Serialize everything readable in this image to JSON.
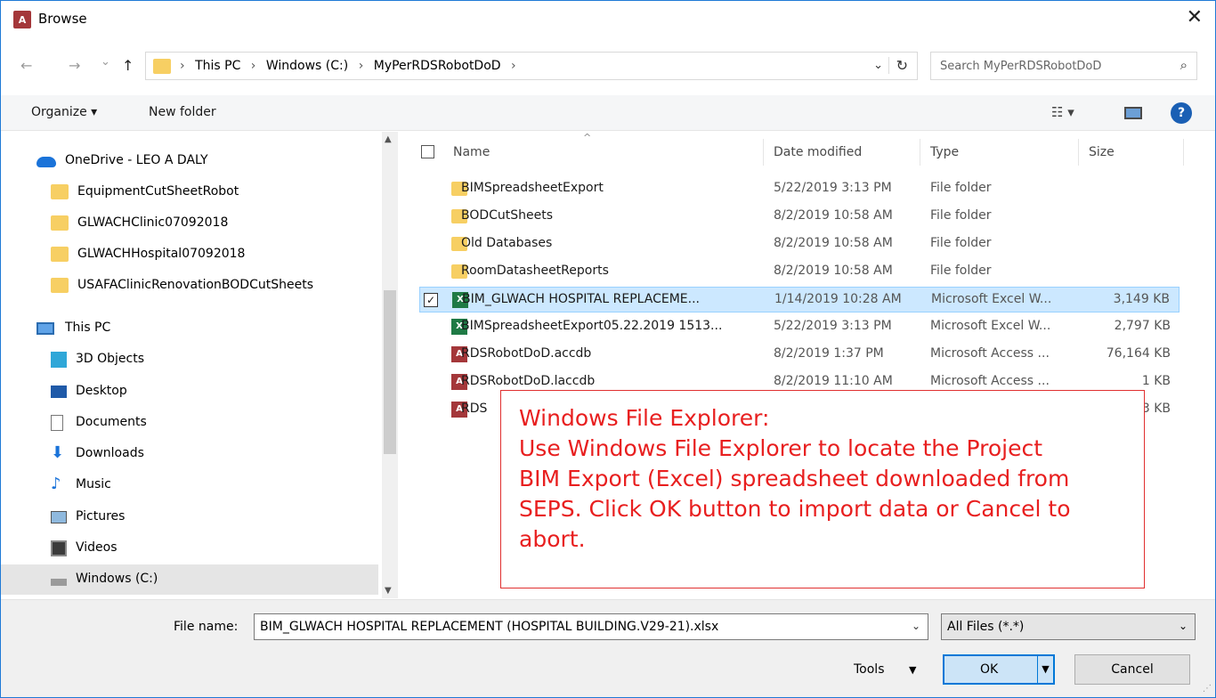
{
  "window": {
    "title": "Browse",
    "app_icon": "A",
    "close_glyph": "✕"
  },
  "nav": {
    "back": "←",
    "forward": "→",
    "recent": "⌄",
    "up": "↑",
    "crumbs": [
      "This PC",
      "Windows (C:)",
      "MyPerRDSRobotDoD"
    ],
    "crumb_sep": "›",
    "search_placeholder": "Search MyPerRDSRobotDoD"
  },
  "toolbar": {
    "organize": "Organize ▾",
    "new_folder": "New folder",
    "help": "?"
  },
  "tree": [
    {
      "label": "OneDrive - LEO A DALY",
      "icon": "cloud-icon"
    },
    {
      "label": "EquipmentCutSheetRobot",
      "icon": "folder-icon"
    },
    {
      "label": "GLWACHClinic07092018",
      "icon": "folder-icon"
    },
    {
      "label": "GLWACHHospital07092018",
      "icon": "folder-icon"
    },
    {
      "label": "USAFAClinicRenovationBODCutSheets",
      "icon": "folder-icon"
    },
    {
      "label": "This PC",
      "icon": "pc-icon"
    },
    {
      "label": "3D Objects",
      "icon": "3d-objects-icon"
    },
    {
      "label": "Desktop",
      "icon": "desktop-icon"
    },
    {
      "label": "Documents",
      "icon": "documents-icon"
    },
    {
      "label": "Downloads",
      "icon": "downloads-icon"
    },
    {
      "label": "Music",
      "icon": "music-icon"
    },
    {
      "label": "Pictures",
      "icon": "pictures-icon"
    },
    {
      "label": "Videos",
      "icon": "videos-icon"
    },
    {
      "label": "Windows (C:)",
      "icon": "drive-icon"
    }
  ],
  "columns": {
    "name": "Name",
    "date": "Date modified",
    "type": "Type",
    "size": "Size"
  },
  "files": [
    {
      "name": "BIMSpreadsheetExport",
      "date": "5/22/2019 3:13 PM",
      "type": "File folder",
      "size": "",
      "kind": "folder"
    },
    {
      "name": "BODCutSheets",
      "date": "8/2/2019 10:58 AM",
      "type": "File folder",
      "size": "",
      "kind": "folder"
    },
    {
      "name": "Old Databases",
      "date": "8/2/2019 10:58 AM",
      "type": "File folder",
      "size": "",
      "kind": "folder"
    },
    {
      "name": "RoomDatasheetReports",
      "date": "8/2/2019 10:58 AM",
      "type": "File folder",
      "size": "",
      "kind": "folder"
    },
    {
      "name": "BIM_GLWACH HOSPITAL REPLACEME...",
      "date": "1/14/2019 10:28 AM",
      "type": "Microsoft Excel W...",
      "size": "3,149 KB",
      "kind": "excel",
      "selected": true
    },
    {
      "name": "BIMSpreadsheetExport05.22.2019 1513...",
      "date": "5/22/2019 3:13 PM",
      "type": "Microsoft Excel W...",
      "size": "2,797 KB",
      "kind": "excel"
    },
    {
      "name": "RDSRobotDoD.accdb",
      "date": "8/2/2019 1:37 PM",
      "type": "Microsoft Access ...",
      "size": "76,164 KB",
      "kind": "access"
    },
    {
      "name": "RDSRobotDoD.laccdb",
      "date": "8/2/2019 11:10 AM",
      "type": "Microsoft Access ...",
      "size": "1 KB",
      "kind": "access"
    },
    {
      "name": "RDS",
      "date": "",
      "type": "",
      "size": "3 KB",
      "kind": "access"
    }
  ],
  "annotation": {
    "lines": [
      "Windows File Explorer:",
      "Use Windows File Explorer to locate the Project",
      "BIM Export (Excel) spreadsheet downloaded from",
      "SEPS.  Click OK button to import data or Cancel to",
      "abort."
    ]
  },
  "bottom": {
    "file_name_label": "File name:",
    "file_name_value": "BIM_GLWACH HOSPITAL REPLACEMENT (HOSPITAL BUILDING.V29-21).xlsx",
    "filter_value": "All Files (*.*)",
    "tools_label": "Tools",
    "ok_label": "OK",
    "cancel_label": "Cancel"
  },
  "colors": {
    "accent": "#0078d7",
    "annotation": "#e81f1f",
    "selection": "#cce8ff"
  }
}
